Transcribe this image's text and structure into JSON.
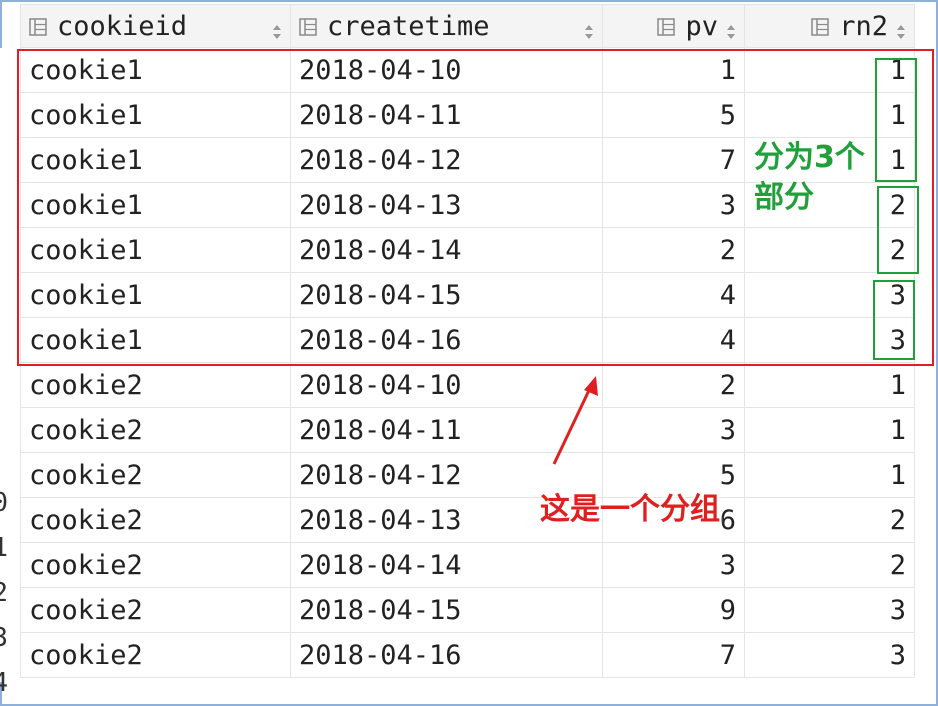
{
  "columns": [
    {
      "label": "cookieid",
      "icon": "column-icon"
    },
    {
      "label": "createtime",
      "icon": "column-icon"
    },
    {
      "label": "pv",
      "icon": "column-icon"
    },
    {
      "label": "rn2",
      "icon": "column-icon"
    }
  ],
  "rows": [
    {
      "cookieid": "cookie1",
      "createtime": "2018-04-10",
      "pv": "1",
      "rn2": "1"
    },
    {
      "cookieid": "cookie1",
      "createtime": "2018-04-11",
      "pv": "5",
      "rn2": "1"
    },
    {
      "cookieid": "cookie1",
      "createtime": "2018-04-12",
      "pv": "7",
      "rn2": "1"
    },
    {
      "cookieid": "cookie1",
      "createtime": "2018-04-13",
      "pv": "3",
      "rn2": "2"
    },
    {
      "cookieid": "cookie1",
      "createtime": "2018-04-14",
      "pv": "2",
      "rn2": "2"
    },
    {
      "cookieid": "cookie1",
      "createtime": "2018-04-15",
      "pv": "4",
      "rn2": "3"
    },
    {
      "cookieid": "cookie1",
      "createtime": "2018-04-16",
      "pv": "4",
      "rn2": "3"
    },
    {
      "cookieid": "cookie2",
      "createtime": "2018-04-10",
      "pv": "2",
      "rn2": "1"
    },
    {
      "cookieid": "cookie2",
      "createtime": "2018-04-11",
      "pv": "3",
      "rn2": "1"
    },
    {
      "cookieid": "cookie2",
      "createtime": "2018-04-12",
      "pv": "5",
      "rn2": "1"
    },
    {
      "cookieid": "cookie2",
      "createtime": "2018-04-13",
      "pv": "6",
      "rn2": "2"
    },
    {
      "cookieid": "cookie2",
      "createtime": "2018-04-14",
      "pv": "3",
      "rn2": "2"
    },
    {
      "cookieid": "cookie2",
      "createtime": "2018-04-15",
      "pv": "9",
      "rn2": "3"
    },
    {
      "cookieid": "cookie2",
      "createtime": "2018-04-16",
      "pv": "7",
      "rn2": "3"
    }
  ],
  "gutter_numbers": [
    "0",
    "1",
    "2",
    "3",
    "4"
  ],
  "annotations": {
    "green_label": "分为3个部分",
    "red_label": "这是一个分组",
    "red_color": "#e02020",
    "green_color": "#21a03a"
  }
}
